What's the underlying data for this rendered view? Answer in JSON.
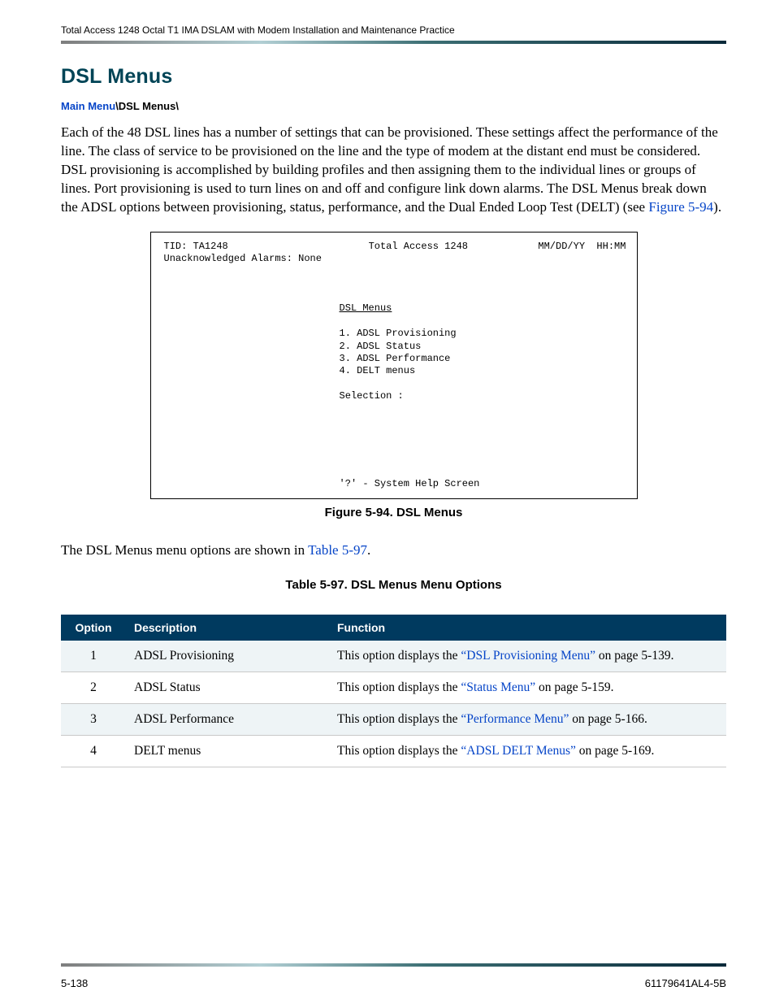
{
  "header": {
    "running": "Total Access 1248 Octal T1 IMA DSLAM with Modem Installation and Maintenance Practice"
  },
  "section": {
    "title": "DSL Menus"
  },
  "breadcrumb": {
    "link": "Main Menu",
    "sep1": "\\",
    "current": "DSL Menus",
    "sep2": "\\"
  },
  "para1": {
    "t1": "Each of the 48 DSL lines has a number of settings that can be provisioned. These settings affect the performance of the line. The class of service to be provisioned on the line and the type of modem at the distant end must be considered. DSL provisioning is accomplished by building profiles and then assigning them to the individual lines or groups of lines. Port provisioning is used to turn lines on and off and configure link down alarms. The DSL Menus break down the ADSL options between provisioning, status, performance, and the Dual Ended Loop Test (DELT) (see ",
    "link": "Figure 5-94",
    "t2": ")."
  },
  "terminal": {
    "tid_label": "TID:",
    "tid_value": "TA1248",
    "product": "Total Access 1248",
    "datetime": "MM/DD/YY  HH:MM",
    "alarms": "Unacknowledged Alarms: None",
    "menu_title": "DSL Menus",
    "item1": "1. ADSL Provisioning",
    "item2": "2. ADSL Status",
    "item3": "3. ADSL Performance",
    "item4": "4. DELT menus",
    "selection": "Selection :",
    "help": "'?' - System Help Screen"
  },
  "figure_caption": "Figure 5-94.  DSL Menus",
  "para2": {
    "t1": "The DSL Menus menu options are shown in ",
    "link": "Table 5-97",
    "t2": "."
  },
  "table_caption": "Table 5-97.  DSL Menus Menu Options",
  "table": {
    "headers": {
      "c1": "Option",
      "c2": "Description",
      "c3": "Function"
    },
    "rows": [
      {
        "option": "1",
        "desc": "ADSL Provisioning",
        "func_pre": "This option displays the ",
        "func_link": "“DSL Provisioning Menu”",
        "func_post": " on page 5-139."
      },
      {
        "option": "2",
        "desc": "ADSL Status",
        "func_pre": "This option displays the ",
        "func_link": "“Status Menu”",
        "func_post": " on page 5-159."
      },
      {
        "option": "3",
        "desc": "ADSL Performance",
        "func_pre": "This option displays the ",
        "func_link": "“Performance Menu”",
        "func_post": " on page 5-166."
      },
      {
        "option": "4",
        "desc": "DELT menus",
        "func_pre": "This option displays the ",
        "func_link": "“ADSL DELT Menus”",
        "func_post": " on page 5-169."
      }
    ]
  },
  "footer": {
    "left": "5-138",
    "right": "61179641AL4-5B"
  }
}
